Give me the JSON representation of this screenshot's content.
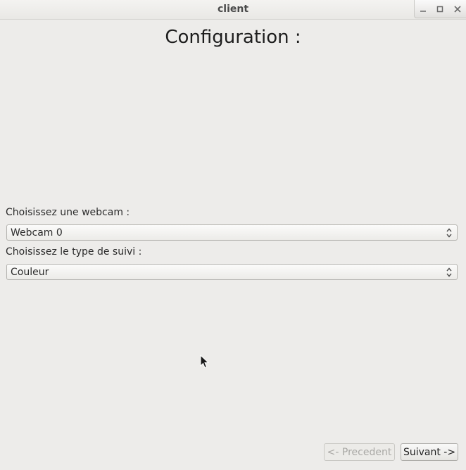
{
  "window": {
    "title": "client",
    "buttons": [
      "minimize-icon",
      "maximize-icon",
      "close-icon"
    ]
  },
  "page": {
    "heading": "Configuration :"
  },
  "webcam": {
    "label": "Choisissez une webcam :",
    "selected": "Webcam 0"
  },
  "tracking": {
    "label": "Choisissez le type de suivi :",
    "selected": "Couleur"
  },
  "nav": {
    "previous_label": "<- Precedent",
    "previous_enabled": false,
    "next_label": "Suivant ->",
    "next_enabled": true
  },
  "colors": {
    "background": "#edecea",
    "disabled_text": "#a9a8a5"
  }
}
